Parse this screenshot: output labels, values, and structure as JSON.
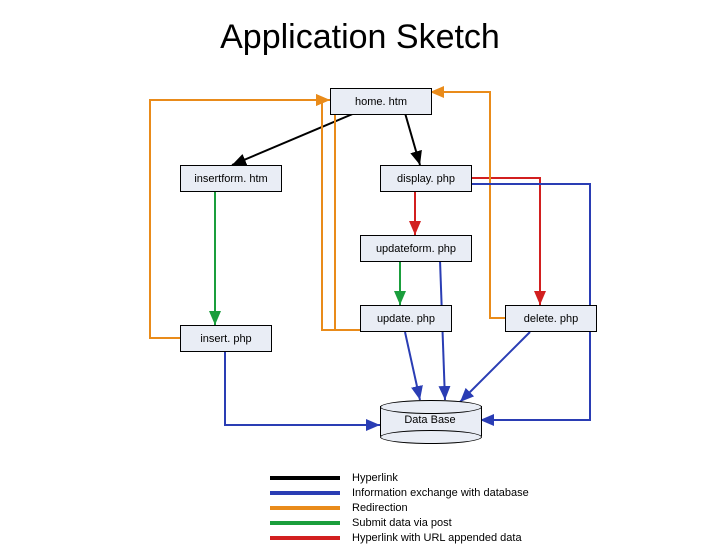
{
  "title": "Application Sketch",
  "nodes": {
    "home": "home. htm",
    "insertform": "insertform. htm",
    "display": "display. php",
    "updateform": "updateform. php",
    "update": "update. php",
    "delete": "delete. php",
    "insert": "insert. php",
    "database": "Data Base"
  },
  "legend": [
    {
      "color": "#000000",
      "label": "Hyperlink"
    },
    {
      "color": "#2a3db4",
      "label": "Information exchange with database"
    },
    {
      "color": "#e98b1a",
      "label": "Redirection"
    },
    {
      "color": "#1a9e3c",
      "label": "Submit data via post"
    },
    {
      "color": "#d21f1f",
      "label": "Hyperlink with URL appended data"
    }
  ],
  "chart_data": {
    "type": "diagram",
    "title": "Application Sketch",
    "nodes": [
      {
        "id": "home",
        "label": "home. htm"
      },
      {
        "id": "insertform",
        "label": "insertform. htm"
      },
      {
        "id": "display",
        "label": "display. php"
      },
      {
        "id": "updateform",
        "label": "updateform. php"
      },
      {
        "id": "update",
        "label": "update. php"
      },
      {
        "id": "delete",
        "label": "delete. php"
      },
      {
        "id": "insert",
        "label": "insert. php"
      },
      {
        "id": "database",
        "label": "Data Base"
      }
    ],
    "edges": [
      {
        "from": "home",
        "to": "insertform",
        "type": "Hyperlink"
      },
      {
        "from": "home",
        "to": "display",
        "type": "Hyperlink"
      },
      {
        "from": "display",
        "to": "updateform",
        "type": "Hyperlink with URL appended data"
      },
      {
        "from": "display",
        "to": "delete",
        "type": "Hyperlink with URL appended data"
      },
      {
        "from": "updateform",
        "to": "update",
        "type": "Submit data via post"
      },
      {
        "from": "insertform",
        "to": "insert",
        "type": "Submit data via post"
      },
      {
        "from": "insert",
        "to": "home",
        "type": "Redirection"
      },
      {
        "from": "update",
        "to": "home",
        "type": "Redirection"
      },
      {
        "from": "delete",
        "to": "home",
        "type": "Redirection"
      },
      {
        "from": "display",
        "to": "database",
        "type": "Information exchange with database"
      },
      {
        "from": "insert",
        "to": "database",
        "type": "Information exchange with database"
      },
      {
        "from": "update",
        "to": "database",
        "type": "Information exchange with database"
      },
      {
        "from": "delete",
        "to": "database",
        "type": "Information exchange with database"
      },
      {
        "from": "updateform",
        "to": "database",
        "type": "Information exchange with database"
      }
    ],
    "legend": [
      {
        "color": "#000000",
        "meaning": "Hyperlink"
      },
      {
        "color": "#2a3db4",
        "meaning": "Information exchange with database"
      },
      {
        "color": "#e98b1a",
        "meaning": "Redirection"
      },
      {
        "color": "#1a9e3c",
        "meaning": "Submit data via post"
      },
      {
        "color": "#d21f1f",
        "meaning": "Hyperlink with URL appended data"
      }
    ]
  }
}
